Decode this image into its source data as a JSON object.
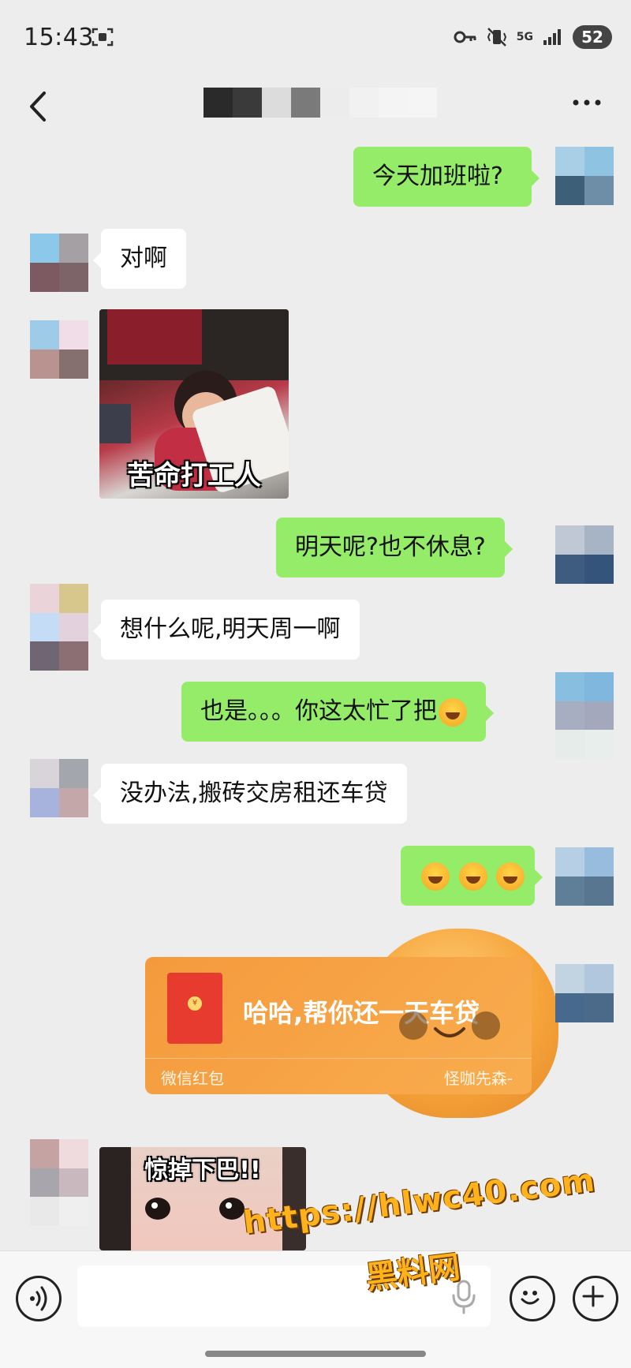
{
  "status_bar": {
    "time": "15:43",
    "network": "5G",
    "battery": "52"
  },
  "nav": {
    "back_icon": "chevron-left-icon",
    "title": "",
    "more_icon": "more-horizontal-icon"
  },
  "messages": [
    {
      "side": "out",
      "text": "今天加班啦?"
    },
    {
      "side": "in",
      "text": "对啊"
    },
    {
      "side": "in",
      "type": "sticker",
      "caption": "苦命打工人"
    },
    {
      "side": "out",
      "text": "明天呢?也不休息?"
    },
    {
      "side": "in",
      "text": "想什么呢,明天周一啊"
    },
    {
      "side": "out",
      "text": "也是。。。你这太忙了把",
      "emoji": "laugh-cry"
    },
    {
      "side": "in",
      "text": "没办法,搬砖交房租还车贷"
    },
    {
      "side": "out",
      "text": "",
      "emoji": "laugh-cry x3"
    },
    {
      "side": "out",
      "type": "red_packet",
      "text": "哈哈,帮你还一天车贷",
      "footer": "微信红包",
      "sender": "怪咖先森-"
    },
    {
      "side": "in",
      "type": "sticker",
      "caption": "惊掉下巴!!"
    }
  ],
  "input_bar": {
    "placeholder": "",
    "voice_icon": "voice-icon",
    "emoji_icon": "emoji-icon",
    "plus_icon": "plus-icon"
  },
  "watermark": {
    "url": "https://hlwc40.com",
    "name": "黑料网"
  },
  "colors": {
    "background": "#ededed",
    "bubble_out": "#95ec69",
    "bubble_in": "#ffffff",
    "red_packet": "#f49a3d",
    "watermark": "#ffb21c"
  }
}
